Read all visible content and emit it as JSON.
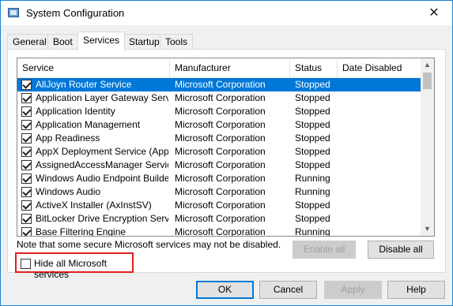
{
  "window": {
    "title": "System Configuration",
    "close_glyph": "✕"
  },
  "tabs": [
    {
      "label": "General",
      "active": false
    },
    {
      "label": "Boot",
      "active": false
    },
    {
      "label": "Services",
      "active": true
    },
    {
      "label": "Startup",
      "active": false
    },
    {
      "label": "Tools",
      "active": false
    }
  ],
  "services": {
    "columns": [
      "Service",
      "Manufacturer",
      "Status",
      "Date Disabled"
    ],
    "rows": [
      {
        "checked": true,
        "selected": true,
        "service": "AllJoyn Router Service",
        "manufacturer": "Microsoft Corporation",
        "status": "Stopped",
        "date_disabled": ""
      },
      {
        "checked": true,
        "selected": false,
        "service": "Application Layer Gateway Service",
        "manufacturer": "Microsoft Corporation",
        "status": "Stopped",
        "date_disabled": ""
      },
      {
        "checked": true,
        "selected": false,
        "service": "Application Identity",
        "manufacturer": "Microsoft Corporation",
        "status": "Stopped",
        "date_disabled": ""
      },
      {
        "checked": true,
        "selected": false,
        "service": "Application Management",
        "manufacturer": "Microsoft Corporation",
        "status": "Stopped",
        "date_disabled": ""
      },
      {
        "checked": true,
        "selected": false,
        "service": "App Readiness",
        "manufacturer": "Microsoft Corporation",
        "status": "Stopped",
        "date_disabled": ""
      },
      {
        "checked": true,
        "selected": false,
        "service": "AppX Deployment Service (AppX...",
        "manufacturer": "Microsoft Corporation",
        "status": "Stopped",
        "date_disabled": ""
      },
      {
        "checked": true,
        "selected": false,
        "service": "AssignedAccessManager Service",
        "manufacturer": "Microsoft Corporation",
        "status": "Stopped",
        "date_disabled": ""
      },
      {
        "checked": true,
        "selected": false,
        "service": "Windows Audio Endpoint Builder",
        "manufacturer": "Microsoft Corporation",
        "status": "Running",
        "date_disabled": ""
      },
      {
        "checked": true,
        "selected": false,
        "service": "Windows Audio",
        "manufacturer": "Microsoft Corporation",
        "status": "Running",
        "date_disabled": ""
      },
      {
        "checked": true,
        "selected": false,
        "service": "ActiveX Installer (AxInstSV)",
        "manufacturer": "Microsoft Corporation",
        "status": "Stopped",
        "date_disabled": ""
      },
      {
        "checked": true,
        "selected": false,
        "service": "BitLocker Drive Encryption Service",
        "manufacturer": "Microsoft Corporation",
        "status": "Stopped",
        "date_disabled": ""
      },
      {
        "checked": true,
        "selected": false,
        "service": "Base Filtering Engine",
        "manufacturer": "Microsoft Corporation",
        "status": "Running",
        "date_disabled": ""
      }
    ]
  },
  "scrollbar": {
    "up_glyph": "▲",
    "down_glyph": "▼"
  },
  "note": "Note that some secure Microsoft services may not be disabled.",
  "enable_all": "Enable all",
  "disable_all": "Disable all",
  "hide_ms": {
    "label": "Hide all Microsoft services",
    "checked": false
  },
  "footer": {
    "ok": "OK",
    "cancel": "Cancel",
    "apply": "Apply",
    "help": "Help"
  },
  "colors": {
    "selection": "#0078d7",
    "highlight_box": "#e02020",
    "window_border": "#1883d7"
  }
}
